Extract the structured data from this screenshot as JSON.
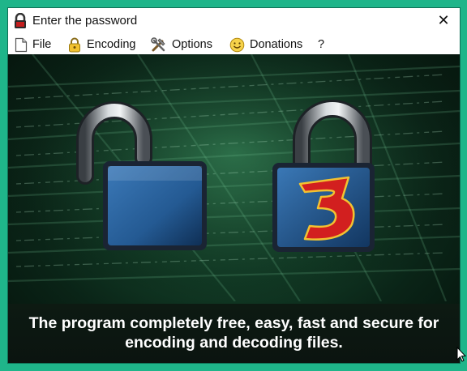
{
  "window": {
    "title": "Enter the password",
    "close_glyph": "✕"
  },
  "menu": {
    "items": [
      {
        "label": "File",
        "icon": "file-icon"
      },
      {
        "label": "Encoding",
        "icon": "lock-icon"
      },
      {
        "label": "Options",
        "icon": "tools-icon"
      },
      {
        "label": "Donations",
        "icon": "smiley-icon"
      },
      {
        "label": "?",
        "icon": ""
      }
    ]
  },
  "banner": {
    "caption_line1": "The program completely free, easy, fast and secure for",
    "caption_line2": "encoding and decoding files.",
    "left_icon": "open-padlock-icon",
    "right_icon": "closed-padlock-3-icon",
    "accent_blue": "#2d6aa8",
    "accent_red": "#d21f1f"
  }
}
